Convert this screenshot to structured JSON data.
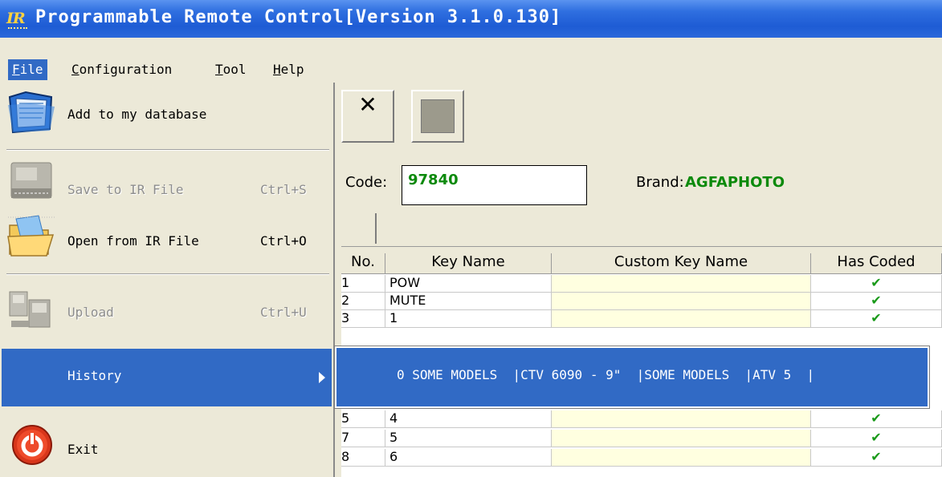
{
  "window": {
    "title": "Programmable Remote Control[Version 3.1.0.130]",
    "icon": "ir-app-icon",
    "icon_text": "IR"
  },
  "menubar": {
    "items": [
      {
        "underline": "F",
        "rest": "ile"
      },
      {
        "underline": "C",
        "rest": "onfiguration"
      },
      {
        "underline": "T",
        "rest": "ool"
      },
      {
        "underline": "H",
        "rest": "elp"
      }
    ]
  },
  "file_menu": {
    "items": [
      {
        "label": "Add to my database",
        "shortcut": "",
        "icon": "folder-icon",
        "enabled": true
      },
      {
        "label": "Save to  IR File",
        "shortcut": "Ctrl+S",
        "icon": "save-ir-icon",
        "enabled": false
      },
      {
        "label": "Open from IR File",
        "shortcut": "Ctrl+O",
        "icon": "open-folder-icon",
        "enabled": true
      },
      {
        "label": "Upload",
        "shortcut": "Ctrl+U",
        "icon": "upload-icon",
        "enabled": false
      },
      {
        "label": "History",
        "shortcut": "",
        "icon": "submenu-arrow-icon",
        "enabled": true,
        "highlighted": true
      },
      {
        "label": "Exit",
        "shortcut": "",
        "icon": "exit-power-icon",
        "enabled": true
      }
    ]
  },
  "history_submenu": {
    "item": "0 SOME MODELS  |CTV 6090 - 9\"  |SOME MODELS  |ATV 5  |"
  },
  "toolbar": {
    "close_glyph": "✕"
  },
  "code_panel": {
    "code_label": "Code:",
    "code_value": "97840",
    "brand_label": "Brand:",
    "brand_value": "AGFAPHOTO",
    "value_color": "#0c8a0c"
  },
  "table": {
    "headers": [
      "No.",
      "Key Name",
      "Custom Key Name",
      "Has Coded"
    ],
    "rows": [
      {
        "no": "1",
        "key": "POW",
        "custom": "",
        "coded": "✔"
      },
      {
        "no": "2",
        "key": "MUTE",
        "custom": "",
        "coded": "✔"
      },
      {
        "no": "3",
        "key": "1",
        "custom": "",
        "coded": "✔"
      },
      {
        "no": "5",
        "key": "4",
        "custom": "",
        "coded": "✔"
      },
      {
        "no": "7",
        "key": "5",
        "custom": "",
        "coded": "✔"
      },
      {
        "no": "8",
        "key": "6",
        "custom": "",
        "coded": "✔"
      }
    ]
  }
}
